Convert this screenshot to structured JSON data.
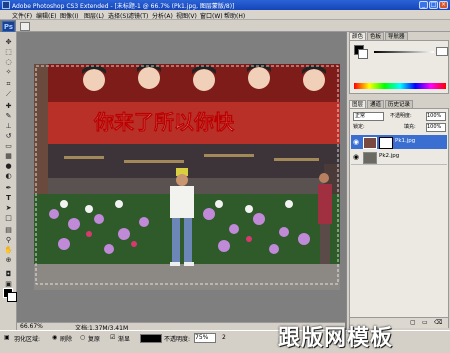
{
  "window": {
    "title": "Adobe Photoshop CS3 Extended - [未标题-1 @ 66.7% (Pk1.jpg, 图层蒙版/8)]"
  },
  "menu": [
    "文件(F)",
    "编辑(E)",
    "图像(I)",
    "图层(L)",
    "选择(S)",
    "滤镜(T)",
    "分析(A)",
    "视图(V)",
    "窗口(W)",
    "帮助(H)"
  ],
  "app": {
    "logo": "Ps"
  },
  "tools": [
    "move-tool",
    "marquee-tool",
    "lasso-tool",
    "magic-wand-tool",
    "crop-tool",
    "slice-tool",
    "healing-brush-tool",
    "brush-tool",
    "clone-stamp-tool",
    "history-brush-tool",
    "eraser-tool",
    "gradient-tool",
    "blur-tool",
    "dodge-tool",
    "pen-tool",
    "type-tool",
    "path-selection-tool",
    "shape-tool",
    "notes-tool",
    "eyedropper-tool",
    "hand-tool",
    "zoom-tool"
  ],
  "canvas": {
    "banner_text": "你来了所以你快"
  },
  "statusbar": {
    "zoom": "66.67%",
    "doc": "文档:1.37M/3.41M"
  },
  "color_panel": {
    "tabs": [
      "颜色",
      "色板",
      "导航器"
    ]
  },
  "layers_panel": {
    "tabs": [
      "图层",
      "通道",
      "历史记录"
    ],
    "blend_mode": "正常",
    "opacity_label": "不透明度:",
    "opacity_value": "100%",
    "fill_label": "填充:",
    "fill_value": "100%",
    "lock_label": "锁定:",
    "layers": [
      {
        "name": "Pk1.jpg",
        "selected": true
      },
      {
        "name": "Pk2.jpg",
        "selected": false
      }
    ]
  },
  "taskbar": {
    "feather_label": "羽化区域:",
    "radio1": "刷除",
    "radio2": "复原",
    "check1": "渐显",
    "opacity_label": "不透明度:",
    "opacity_value": "75%",
    "extra": "2"
  },
  "watermark": "跟版网模板"
}
